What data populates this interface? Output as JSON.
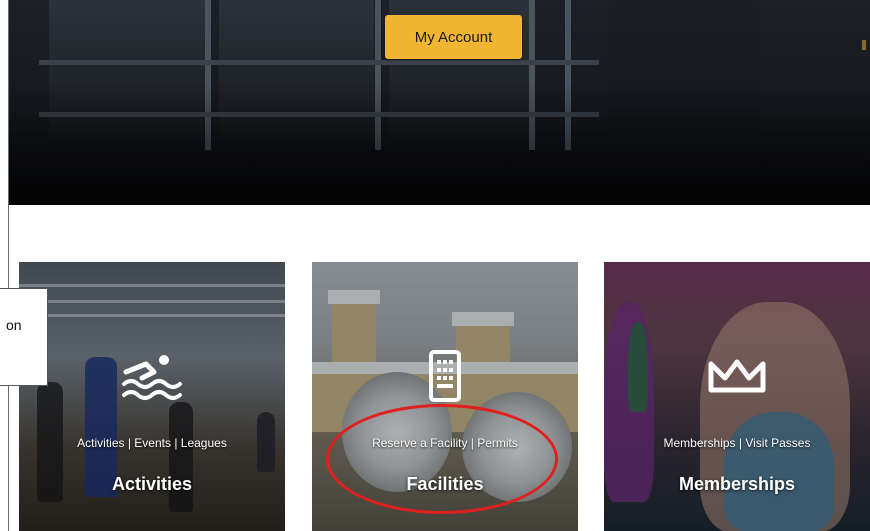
{
  "hero": {
    "account_button": "My Account"
  },
  "callout": {
    "text": "on"
  },
  "cards": [
    {
      "subtitle": "Activities | Events | Leagues",
      "title": "Activities",
      "icon": "swimmer-icon"
    },
    {
      "subtitle": "Reserve a Facility | Permits",
      "title": "Facilities",
      "icon": "building-icon"
    },
    {
      "subtitle": "Memberships | Visit Passes",
      "title": "Memberships",
      "icon": "crown-icon"
    }
  ],
  "colors": {
    "account_button_bg": "#f2b533",
    "highlight": "#e01f1f"
  }
}
